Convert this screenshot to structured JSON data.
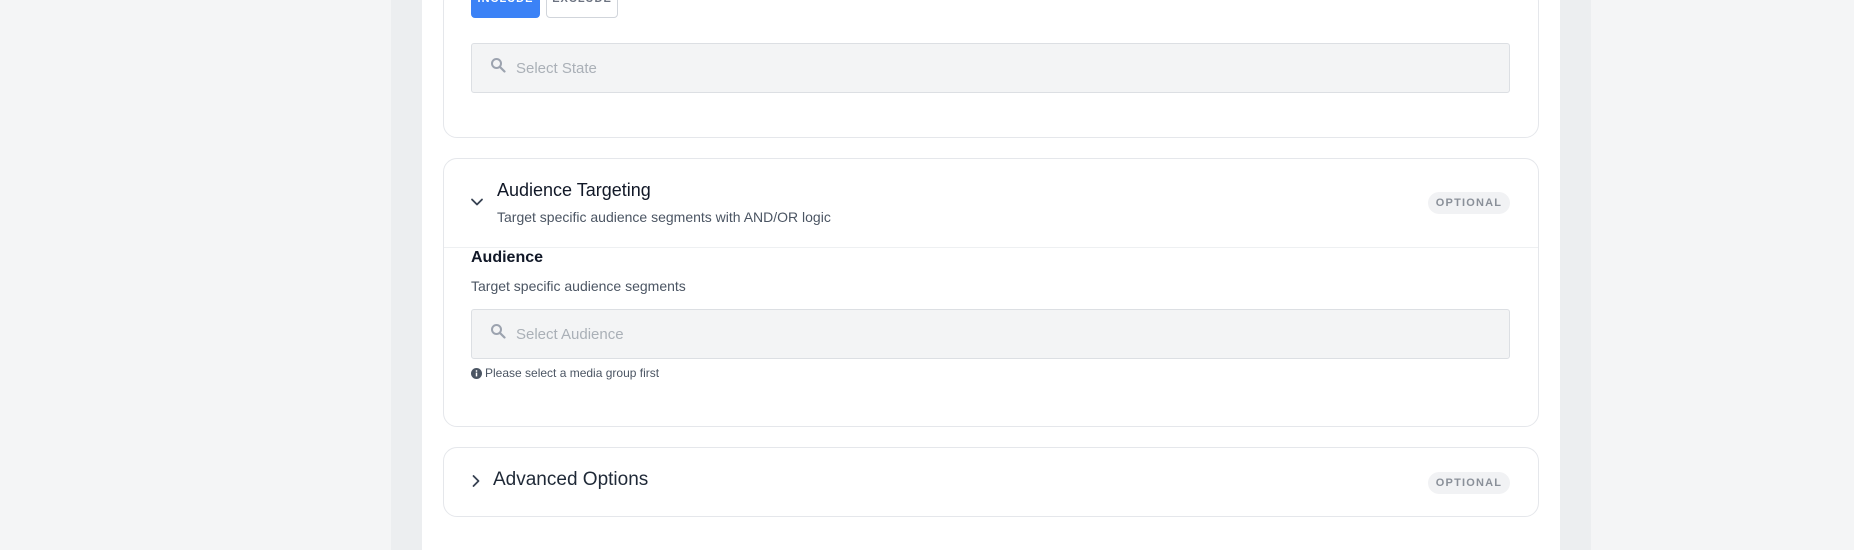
{
  "location": {
    "include_label": "INCLUDE",
    "exclude_label": "EXCLUDE",
    "state_select": {
      "placeholder": "Select State",
      "icon": "search-icon"
    }
  },
  "audience_section": {
    "title": "Audience Targeting",
    "subtitle": "Target specific audience segments with AND/OR logic",
    "badge": "OPTIONAL",
    "expanded": true,
    "field": {
      "label": "Audience",
      "help": "Target specific audience segments",
      "placeholder": "Select Audience",
      "notice": "Please select a media group first"
    }
  },
  "advanced_section": {
    "title": "Advanced Options",
    "badge": "OPTIONAL",
    "expanded": false
  },
  "colors": {
    "accent": "#3b82f6",
    "badge_bg": "#f1f2f4",
    "input_bg": "#f3f4f5"
  }
}
